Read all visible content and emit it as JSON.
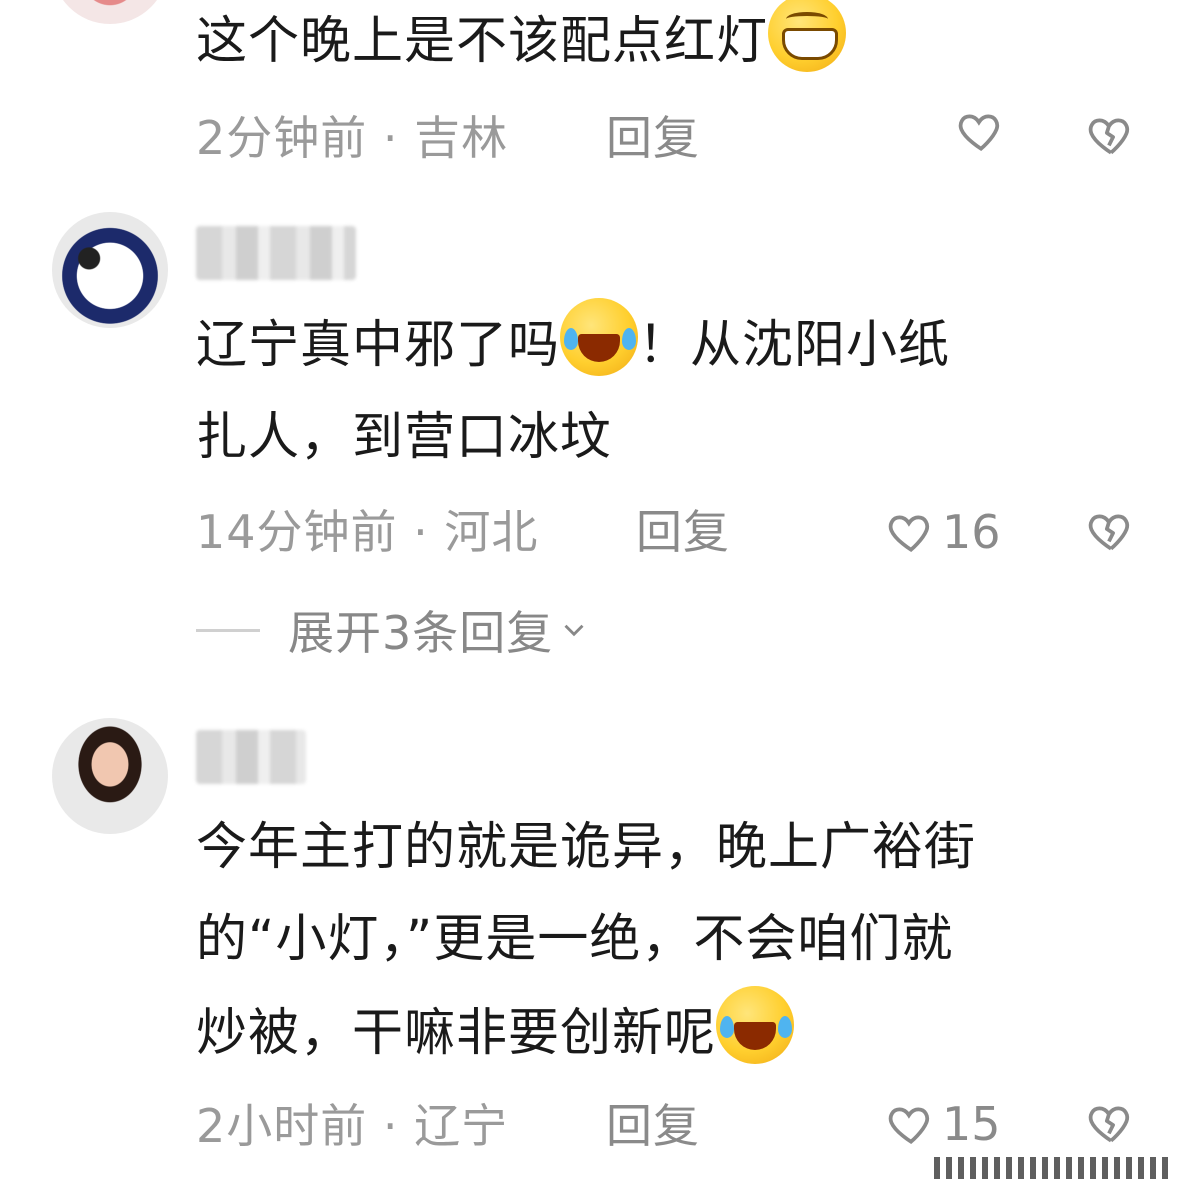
{
  "comments": [
    {
      "text": "这个晚上是不该配点红灯",
      "emoji": "grin-emoji",
      "time": "2分钟前",
      "location": "吉林",
      "reply_label": "回复",
      "like_count": ""
    },
    {
      "text_line1": "辽宁真中邪了吗",
      "text_line1b": "！从沈阳小纸",
      "text_line2": "扎人，到营口冰坟",
      "emoji": "laugh-cry-emoji",
      "time": "14分钟前",
      "location": "河北",
      "reply_label": "回复",
      "like_count": "16",
      "expand_label": "展开3条回复"
    },
    {
      "text_line1": "今年主打的就是诡异，晚上广裕街",
      "text_line2": "的“小灯，”更是一绝，不会咱们就",
      "text_line3": "炒被，干嘛非要创新呢",
      "emoji": "laugh-cry-emoji",
      "time": "2小时前",
      "location": "辽宁",
      "reply_label": "回复",
      "like_count": "15"
    }
  ],
  "separator": "·",
  "colors": {
    "text": "#1a1a1a",
    "meta": "#9a9a9a",
    "emoji": "#ffcf2e"
  }
}
